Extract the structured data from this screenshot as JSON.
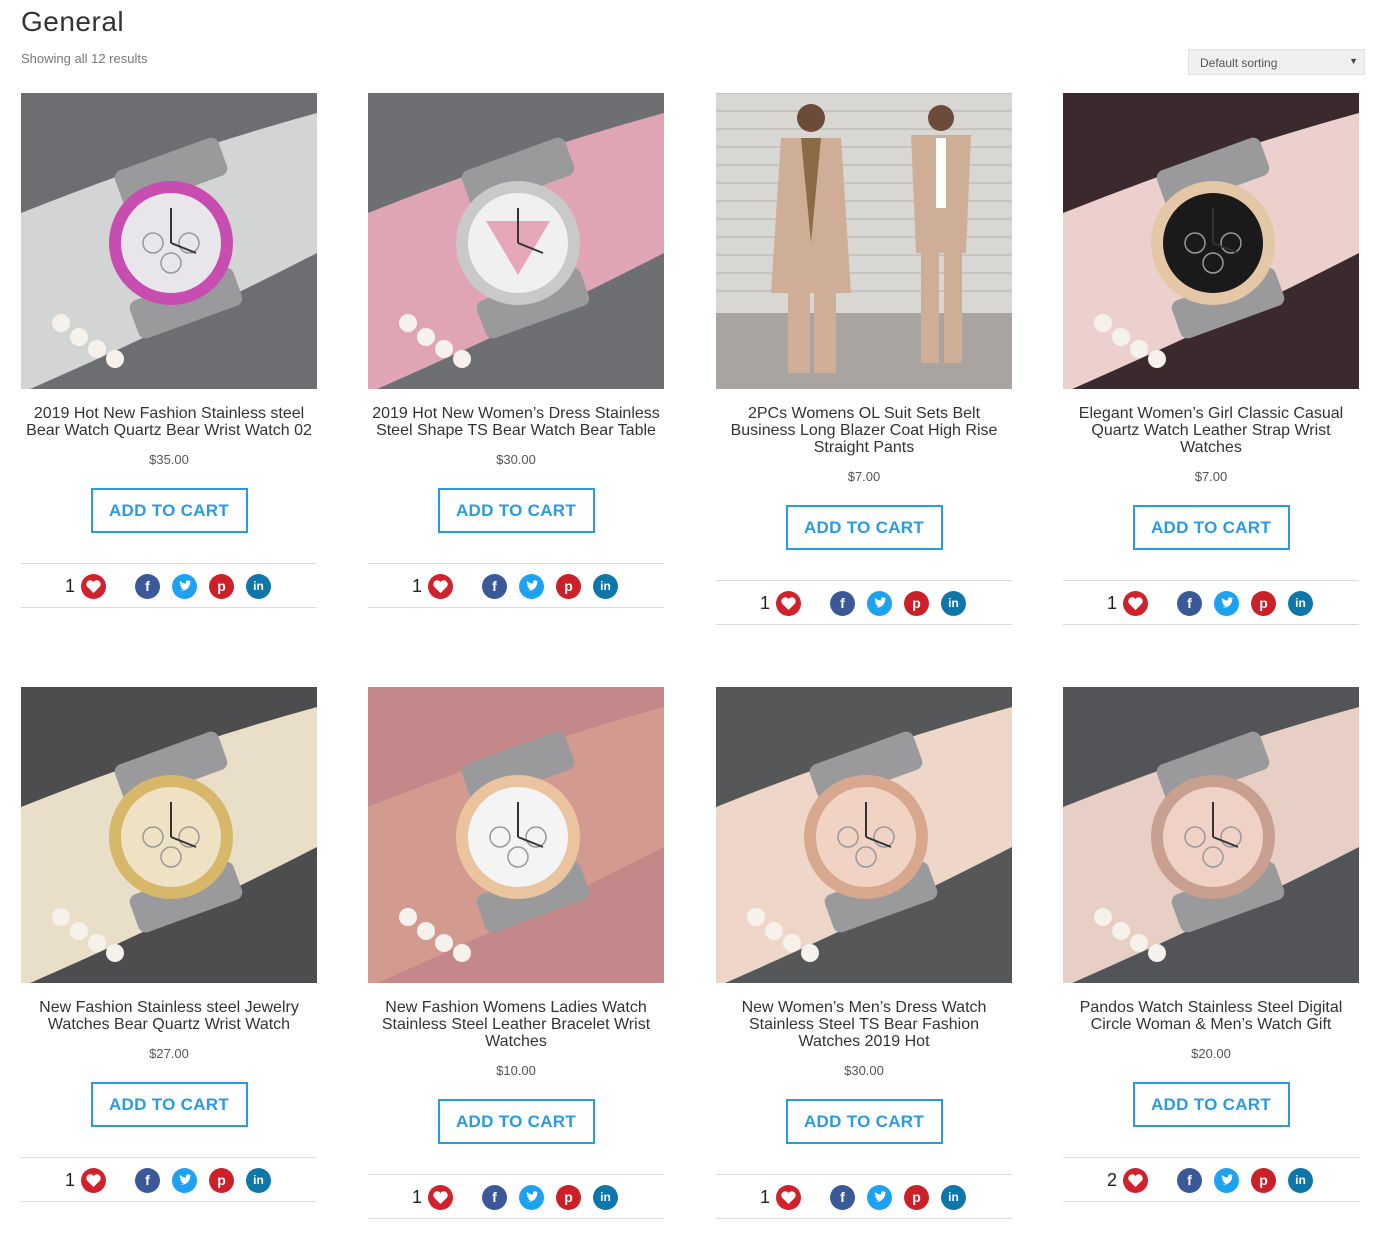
{
  "header": {
    "title": "General",
    "result_count": "Showing all 12 results",
    "sorting": "Default sorting"
  },
  "labels": {
    "add_to_cart": "ADD TO CART"
  },
  "products": [
    {
      "title": "2019 Hot New Fashion Stainless steel Bear Watch Quartz Bear Wrist Watch 02",
      "price": "$35.00",
      "likes": "1",
      "image": "pink-bezel-watch-photo"
    },
    {
      "title": "2019 Hot New Women’s Dress Stainless Steel Shape TS Bear Watch Bear Table",
      "price": "$30.00",
      "likes": "1",
      "image": "silver-triangle-watch-photo"
    },
    {
      "title": "2PCs Womens OL Suit Sets Belt Business Long Blazer Coat High Rise Straight Pants",
      "price": "$7.00",
      "likes": "1",
      "image": "beige-suit-photo"
    },
    {
      "title": "Elegant Women’s Girl Classic Casual Quartz Watch Leather Strap Wrist Watches",
      "price": "$7.00",
      "likes": "1",
      "image": "black-strap-watch-photo"
    },
    {
      "title": "New Fashion Stainless steel Jewelry Watches Bear Quartz Wrist Watch",
      "price": "$27.00",
      "likes": "1",
      "image": "gold-bear-watch-photo"
    },
    {
      "title": "New Fashion Womens Ladies Watch Stainless Steel Leather Bracelet Wrist Watches",
      "price": "$10.00",
      "likes": "1",
      "image": "wrap-bracelet-watch-photo"
    },
    {
      "title": "New Women’s Men’s Dress Watch Stainless Steel TS Bear Fashion Watches 2019 Hot",
      "price": "$30.00",
      "likes": "1",
      "image": "rose-gold-chrono-watch-photo"
    },
    {
      "title": "Pandos Watch Stainless Steel Digital Circle Woman & Men’s Watch Gift",
      "price": "$20.00",
      "likes": "2",
      "image": "pink-dial-watch-photo"
    }
  ],
  "colors": {
    "accent": "#2a9ae4",
    "facebook": "#3b5998",
    "twitter": "#1da1f2",
    "pinterest": "#cb2027",
    "linkedin": "#0e76a8",
    "heart": "#d0212d"
  },
  "icons": [
    "heart-icon",
    "facebook-icon",
    "twitter-icon",
    "pinterest-icon",
    "linkedin-icon",
    "chevron-down-icon"
  ]
}
